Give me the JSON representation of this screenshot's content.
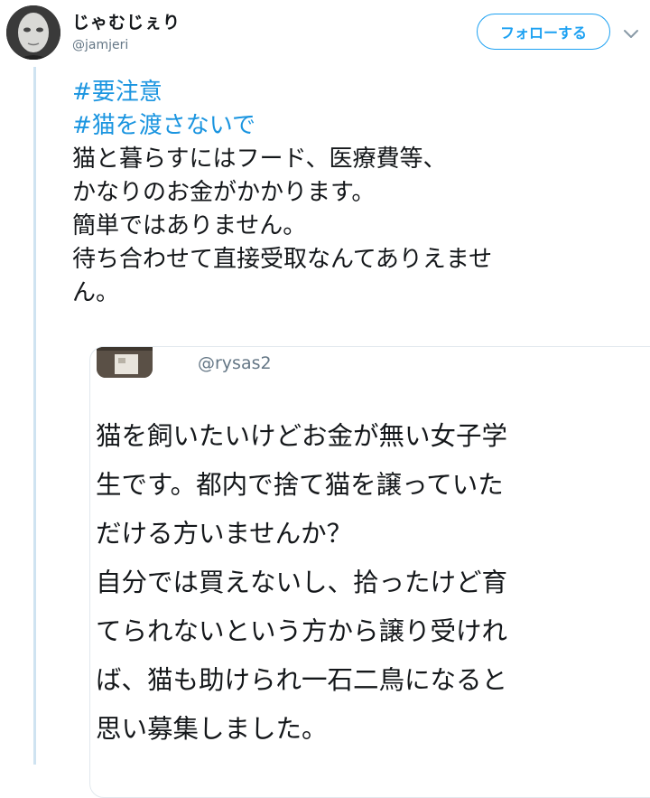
{
  "author": {
    "display_name": "じゃむじぇり",
    "handle": "@jamjeri",
    "avatar_icon": "masked-face-avatar"
  },
  "follow_label": "フォローする",
  "tweet": {
    "hashtags": [
      "#要注意",
      "#猫を渡さないで"
    ],
    "lines": [
      "猫と暮らすにはフード、医療費等、",
      "かなりのお金がかかります。",
      "簡単ではありません。",
      "待ち合わせて直接受取なんてありえませ",
      "ん。"
    ]
  },
  "quoted_tweet": {
    "handle": "@rysas2",
    "lines": [
      "猫を飼いたいけどお金が無い女子学",
      "生です。都内で捨て猫を譲っていた",
      "だける方いませんか？",
      "自分では買えないし、拾ったけど育",
      "てられないという方から譲り受けれ",
      "ば、猫も助けられ一石二鳥になると",
      "思い募集しました。"
    ]
  },
  "colors": {
    "accent": "#1da1f2",
    "hashtag": "#1b95e0",
    "muted": "#657786",
    "thread_line": "#cfe3f1"
  }
}
